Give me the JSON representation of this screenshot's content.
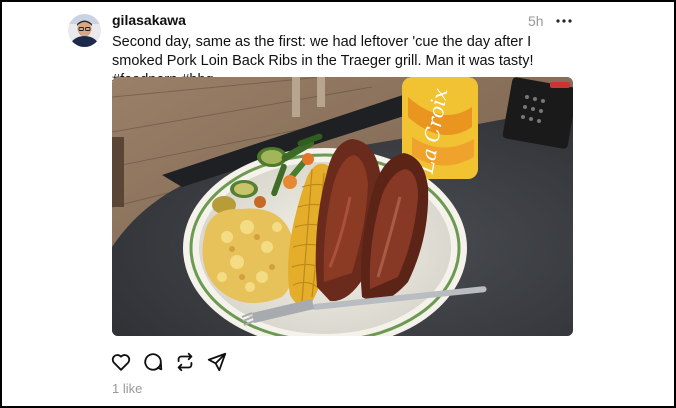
{
  "post": {
    "username": "gilasakawa",
    "timestamp": "5h",
    "more_icon": "ellipsis-icon",
    "caption": "Second day, same as the first: we had leftover 'cue the day after I smoked Pork Loin Back Ribs in the Traeger grill. Man it was tasty! #foodporn #bbq",
    "photo": {
      "can_text": "La Croix"
    }
  },
  "actions": {
    "like_icon": "heart-icon",
    "comment_icon": "comment-icon",
    "repost_icon": "repost-icon",
    "share_icon": "send-icon"
  },
  "stats": {
    "likes": "1 like"
  },
  "colors": {
    "text": "#101010",
    "muted": "#999999"
  }
}
